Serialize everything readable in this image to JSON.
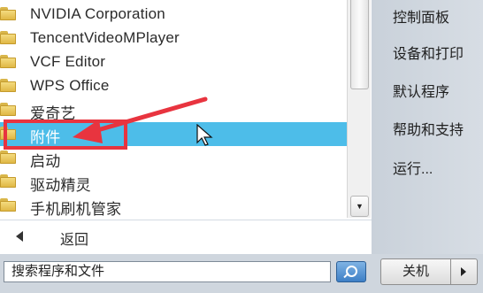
{
  "programs": {
    "items": [
      {
        "label": "NVIDIA Corporation"
      },
      {
        "label": "TencentVideoMPlayer"
      },
      {
        "label": "VCF Editor"
      },
      {
        "label": "WPS Office"
      },
      {
        "label": "爱奇艺"
      },
      {
        "label": "附件",
        "selected": true
      },
      {
        "label": "启动"
      },
      {
        "label": "驱动精灵"
      },
      {
        "label": "手机刷机管家"
      }
    ],
    "back_label": "返回"
  },
  "search": {
    "value": "搜索程序和文件",
    "icon": "search-icon"
  },
  "right_menu": {
    "items": [
      {
        "label": "控制面板"
      },
      {
        "label": "设备和打印"
      },
      {
        "label": "默认程序"
      },
      {
        "label": "帮助和支持"
      },
      {
        "label": "运行..."
      }
    ]
  },
  "shutdown": {
    "label": "关机",
    "arrow_icon": "arrow-right-icon"
  },
  "colors": {
    "selection": "#4dbde9",
    "annotation": "#e8343f",
    "right_pane": "#cfd6de"
  }
}
